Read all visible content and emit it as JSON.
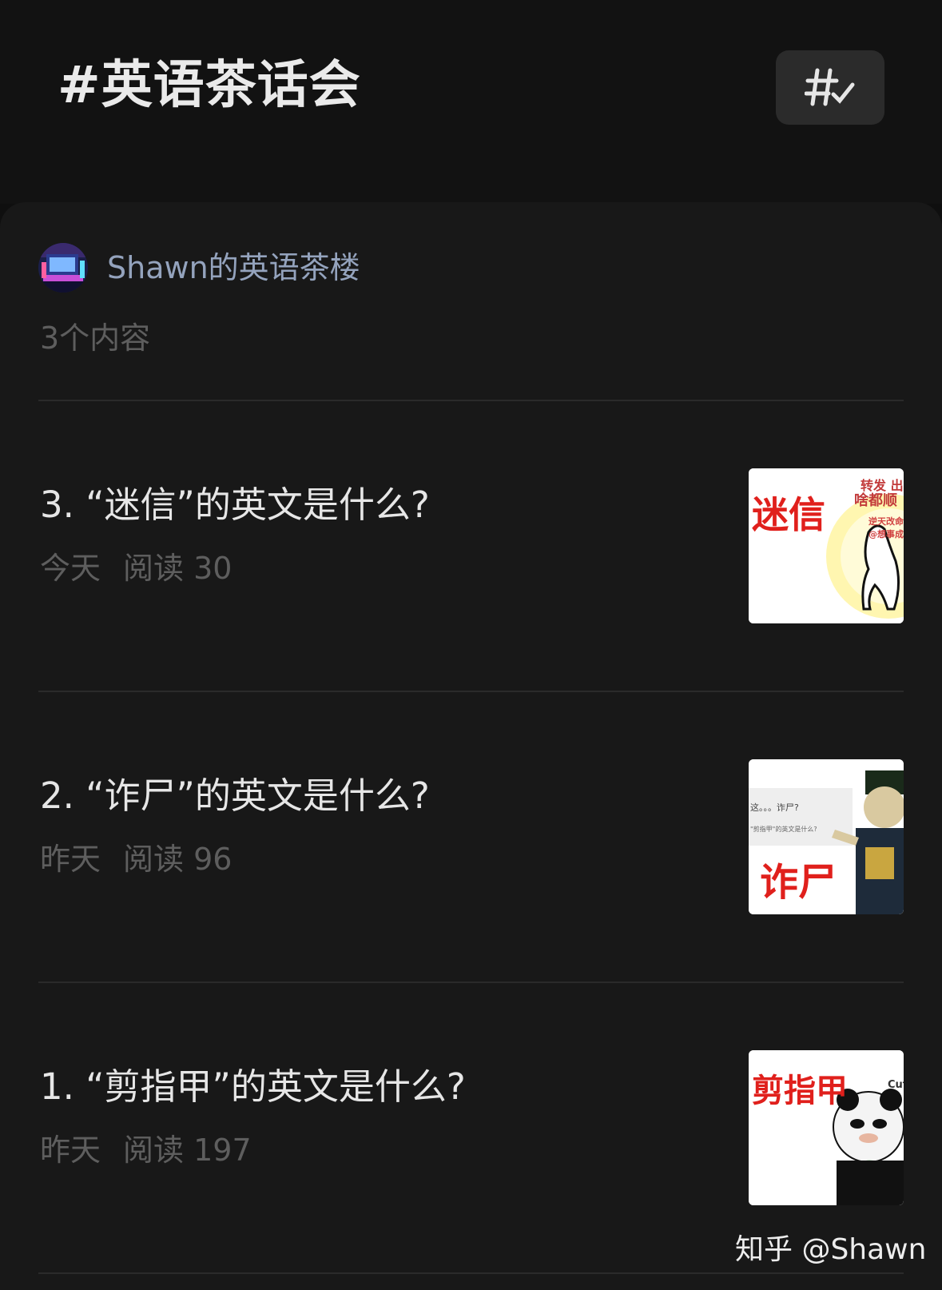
{
  "header": {
    "title": "#英语茶话会",
    "tag_button_icon": "hashtag-check-icon"
  },
  "author": {
    "name": "Shawn的英语茶楼",
    "avatar_icon": "avatar-image"
  },
  "content_count": "3个内容",
  "items": [
    {
      "title": "3. “迷信”的英文是什么?",
      "date": "今天",
      "reads": "阅读 30",
      "thumb_text": "迷信",
      "thumb_small": [
        "转发 出",
        "啥都顺",
        "逆天改命",
        "@想事成"
      ]
    },
    {
      "title": "2. “诈尸”的英文是什么?",
      "date": "昨天",
      "reads": "阅读 96",
      "thumb_text": "诈尸",
      "thumb_small": [
        "这。。。诈尸?",
        "\"剪指甲\"的英文是什么?"
      ]
    },
    {
      "title": "1. “剪指甲”的英文是什么?",
      "date": "昨天",
      "reads": "阅读 197",
      "thumb_text": "剪指甲",
      "thumb_small": [
        "Cut"
      ]
    }
  ],
  "watermark": "知乎 @Shawn",
  "colors": {
    "background": "#0f0f0f",
    "card": "#181818",
    "author_name": "#94a3bd",
    "meta": "#5e5e5e",
    "thumb_red": "#e0201c"
  }
}
